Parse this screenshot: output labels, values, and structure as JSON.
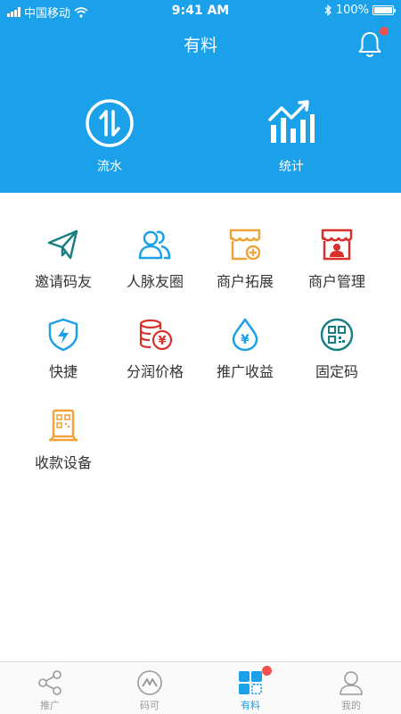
{
  "status_bar": {
    "carrier": "中国移动",
    "time": "9:41 AM",
    "battery": "100%"
  },
  "header": {
    "title": "有料",
    "hero": [
      {
        "label": "流水",
        "icon": "up-down-arrows-icon"
      },
      {
        "label": "统计",
        "icon": "bar-chart-trend-icon"
      }
    ]
  },
  "grid": [
    {
      "label": "邀请码友",
      "icon": "paper-plane-icon",
      "color": "#1a7f83"
    },
    {
      "label": "人脉友圈",
      "icon": "contacts-icon",
      "color": "#1ba0ea"
    },
    {
      "label": "商户拓展",
      "icon": "shop-add-icon",
      "color": "#f0a33a"
    },
    {
      "label": "商户管理",
      "icon": "shop-manage-icon",
      "color": "#d9302b"
    },
    {
      "label": "快捷",
      "icon": "shield-bolt-icon",
      "color": "#1ba0ea"
    },
    {
      "label": "分润价格",
      "icon": "coins-icon",
      "color": "#d9302b"
    },
    {
      "label": "推广收益",
      "icon": "yuan-drop-icon",
      "color": "#1ba0ea"
    },
    {
      "label": "固定码",
      "icon": "qr-code-icon",
      "color": "#1a7f83"
    },
    {
      "label": "收款设备",
      "icon": "pos-device-icon",
      "color": "#f0a33a"
    }
  ],
  "tabs": [
    {
      "label": "推广",
      "icon": "share-icon",
      "active": false
    },
    {
      "label": "码可",
      "icon": "brand-logo-icon",
      "active": false
    },
    {
      "label": "有料",
      "icon": "apps-grid-icon",
      "active": true
    },
    {
      "label": "我的",
      "icon": "user-icon",
      "active": false
    }
  ],
  "colors": {
    "primary": "#1ba0ea",
    "badge": "#f0524f",
    "inactive": "#9a9a9a"
  }
}
